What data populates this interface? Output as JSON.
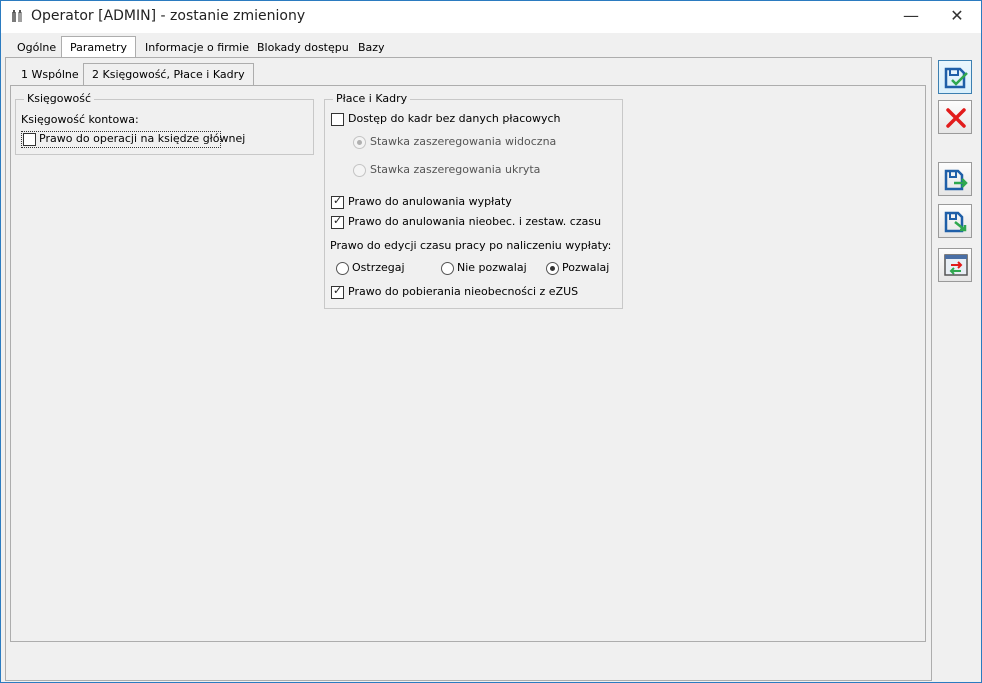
{
  "window": {
    "title": "Operator [ADMIN] - zostanie zmieniony",
    "minimize_glyph": "—",
    "close_glyph": "✕"
  },
  "tabs": [
    {
      "label": "Ogólne"
    },
    {
      "label": "Parametry"
    },
    {
      "label": "Informacje o firmie"
    },
    {
      "label": "Blokady dostępu"
    },
    {
      "label": "Bazy"
    }
  ],
  "subtabs": [
    {
      "label": "1 Wspólne"
    },
    {
      "label": "2 Księgowość, Płace i Kadry"
    }
  ],
  "ksiegowosc": {
    "title": "Księgowość",
    "section_label": "Księgowość kontowa:",
    "ksiega_glowna_label": "Prawo do operacji na księdze głównej"
  },
  "place_kadry": {
    "title": "Płace i Kadry",
    "dostep_label": "Dostęp do kadr bez danych płacowych",
    "stawka_widoczna_label": "Stawka zaszeregowania widoczna",
    "stawka_ukryta_label": "Stawka zaszeregowania ukryta",
    "anulowanie_wyplaty_label": "Prawo do anulowania wypłaty",
    "anulowanie_nieobec_label": "Prawo do anulowania nieobec. i zestaw. czasu",
    "edycja_label": "Prawo do edycji czasu pracy po naliczeniu wypłaty:",
    "opt_ostrzegaj": "Ostrzegaj",
    "opt_nie_pozwalaj": "Nie pozwalaj",
    "opt_pozwalaj": "Pozwalaj",
    "ezus_label": "Prawo do pobierania nieobecności z eZUS"
  },
  "state": {
    "ksiega_glowna": false,
    "dostep_kadr": false,
    "stawka": "widoczna",
    "anulowanie_wyplaty": true,
    "anulowanie_nieobec": true,
    "edycja": "pozwalaj",
    "ezus": true
  },
  "colors": {
    "accent": "#2b7bc0",
    "save_icon_blue": "#1f5fa8",
    "cancel_red": "#e21b1b",
    "arrow_green": "#2fa84f"
  },
  "side_buttons": [
    {
      "icon": "save-icon"
    },
    {
      "icon": "cancel-icon"
    },
    {
      "icon": "save-next-icon"
    },
    {
      "icon": "save-prev-icon"
    },
    {
      "icon": "screen-arrows-icon"
    }
  ]
}
